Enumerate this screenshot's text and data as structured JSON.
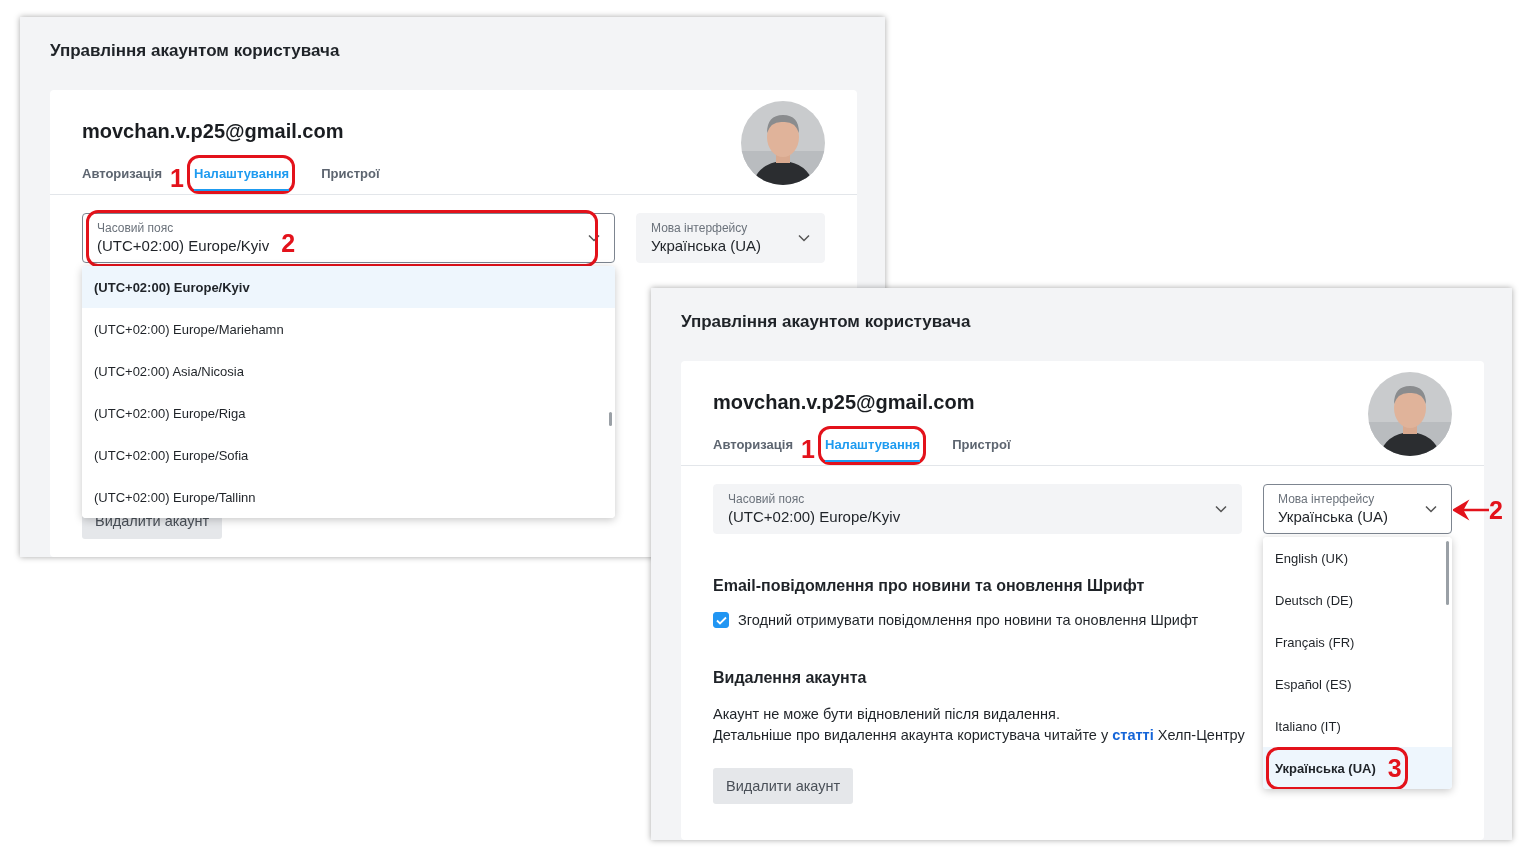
{
  "left_screenshot": {
    "title": "Управління акаунтом користувача",
    "email": "movchan.v.p25@gmail.com",
    "tabs": [
      {
        "label": "Авторизація",
        "selected": false
      },
      {
        "label": "Налаштування",
        "selected": true,
        "annotation": {
          "number": "1",
          "kind": "oval"
        }
      },
      {
        "label": "Пристрої",
        "selected": false
      }
    ],
    "timezone": {
      "label": "Часовий пояс",
      "value": "(UTC+02:00) Europe/Kyiv",
      "focused": true,
      "expanded": true,
      "annotation": {
        "number": "2",
        "kind": "oval"
      },
      "options": [
        {
          "label": "(UTC+02:00) Europe/Kyiv",
          "selected": true
        },
        {
          "label": "(UTC+02:00) Europe/Mariehamn",
          "selected": false
        },
        {
          "label": "(UTC+02:00) Asia/Nicosia",
          "selected": false
        },
        {
          "label": "(UTC+02:00) Europe/Riga",
          "selected": false
        },
        {
          "label": "(UTC+02:00) Europe/Sofia",
          "selected": false
        },
        {
          "label": "(UTC+02:00) Europe/Tallinn",
          "selected": false
        }
      ]
    },
    "language": {
      "label": "Мова інтерфейсу",
      "value": "Українська (UA)",
      "focused": false
    },
    "delete_button": "Видалити акаунт"
  },
  "right_screenshot": {
    "title": "Управління акаунтом користувача",
    "email": "movchan.v.p25@gmail.com",
    "tabs": [
      {
        "label": "Авторизація",
        "selected": false
      },
      {
        "label": "Налаштування",
        "selected": true,
        "annotation": {
          "number": "1",
          "kind": "oval"
        }
      },
      {
        "label": "Пристрої",
        "selected": false
      }
    ],
    "timezone": {
      "label": "Часовий пояс",
      "value": "(UTC+02:00) Europe/Kyiv",
      "focused": false
    },
    "language": {
      "label": "Мова інтерфейсу",
      "value": "Українська (UA)",
      "focused": true,
      "expanded": true,
      "annotation": {
        "number": "2",
        "kind": "arrow"
      },
      "options": [
        {
          "label": "English (UK)",
          "selected": false
        },
        {
          "label": "Deutsch (DE)",
          "selected": false
        },
        {
          "label": "Français (FR)",
          "selected": false
        },
        {
          "label": "Español (ES)",
          "selected": false
        },
        {
          "label": "Italiano (IT)",
          "selected": false
        },
        {
          "label": "Українська (UA)",
          "selected": true,
          "annotation": {
            "number": "3",
            "kind": "oval"
          }
        }
      ]
    },
    "email_section": {
      "heading": "Email-повідомлення про новини та оновлення Шрифт",
      "checkbox": {
        "label": "Згодний отримувати повідомлення про новини та оновлення Шрифт",
        "checked": true
      }
    },
    "deletion_section": {
      "heading": "Видалення акаунта",
      "line_1": "Акаунт не може бути відновлений після видалення.",
      "line_2": {
        "before": "Детальніше про видалення акаунта користувача читайте у",
        "link": "статті",
        "after": "Хелп-Центру"
      }
    },
    "delete_button": "Видалити акаунт"
  }
}
